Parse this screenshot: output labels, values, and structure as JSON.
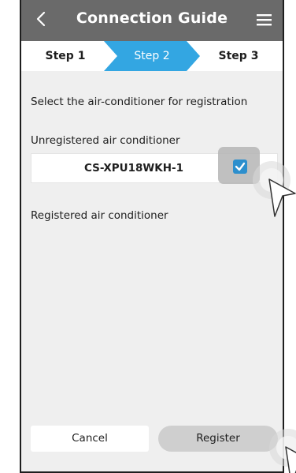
{
  "header": {
    "title": "Connection Guide",
    "back_icon": "chevron-left-icon",
    "menu_icon": "hamburger-menu-icon"
  },
  "steps": [
    {
      "label": "Step 1",
      "active": false
    },
    {
      "label": "Step 2",
      "active": true
    },
    {
      "label": "Step 3",
      "active": false
    }
  ],
  "colors": {
    "header_bg": "#6a6a6a",
    "active_step": "#33a6e2",
    "checkbox": "#2d8fcd",
    "content_bg": "#efefef"
  },
  "main": {
    "instruction": "Select the air-conditioner for registration",
    "unregistered_heading": "Unregistered air conditioner",
    "unregistered_items": [
      {
        "name": "CS-XPU18WKH-1",
        "checked": true
      }
    ],
    "registered_heading": "Registered air conditioner"
  },
  "footer": {
    "cancel_label": "Cancel",
    "register_label": "Register"
  }
}
